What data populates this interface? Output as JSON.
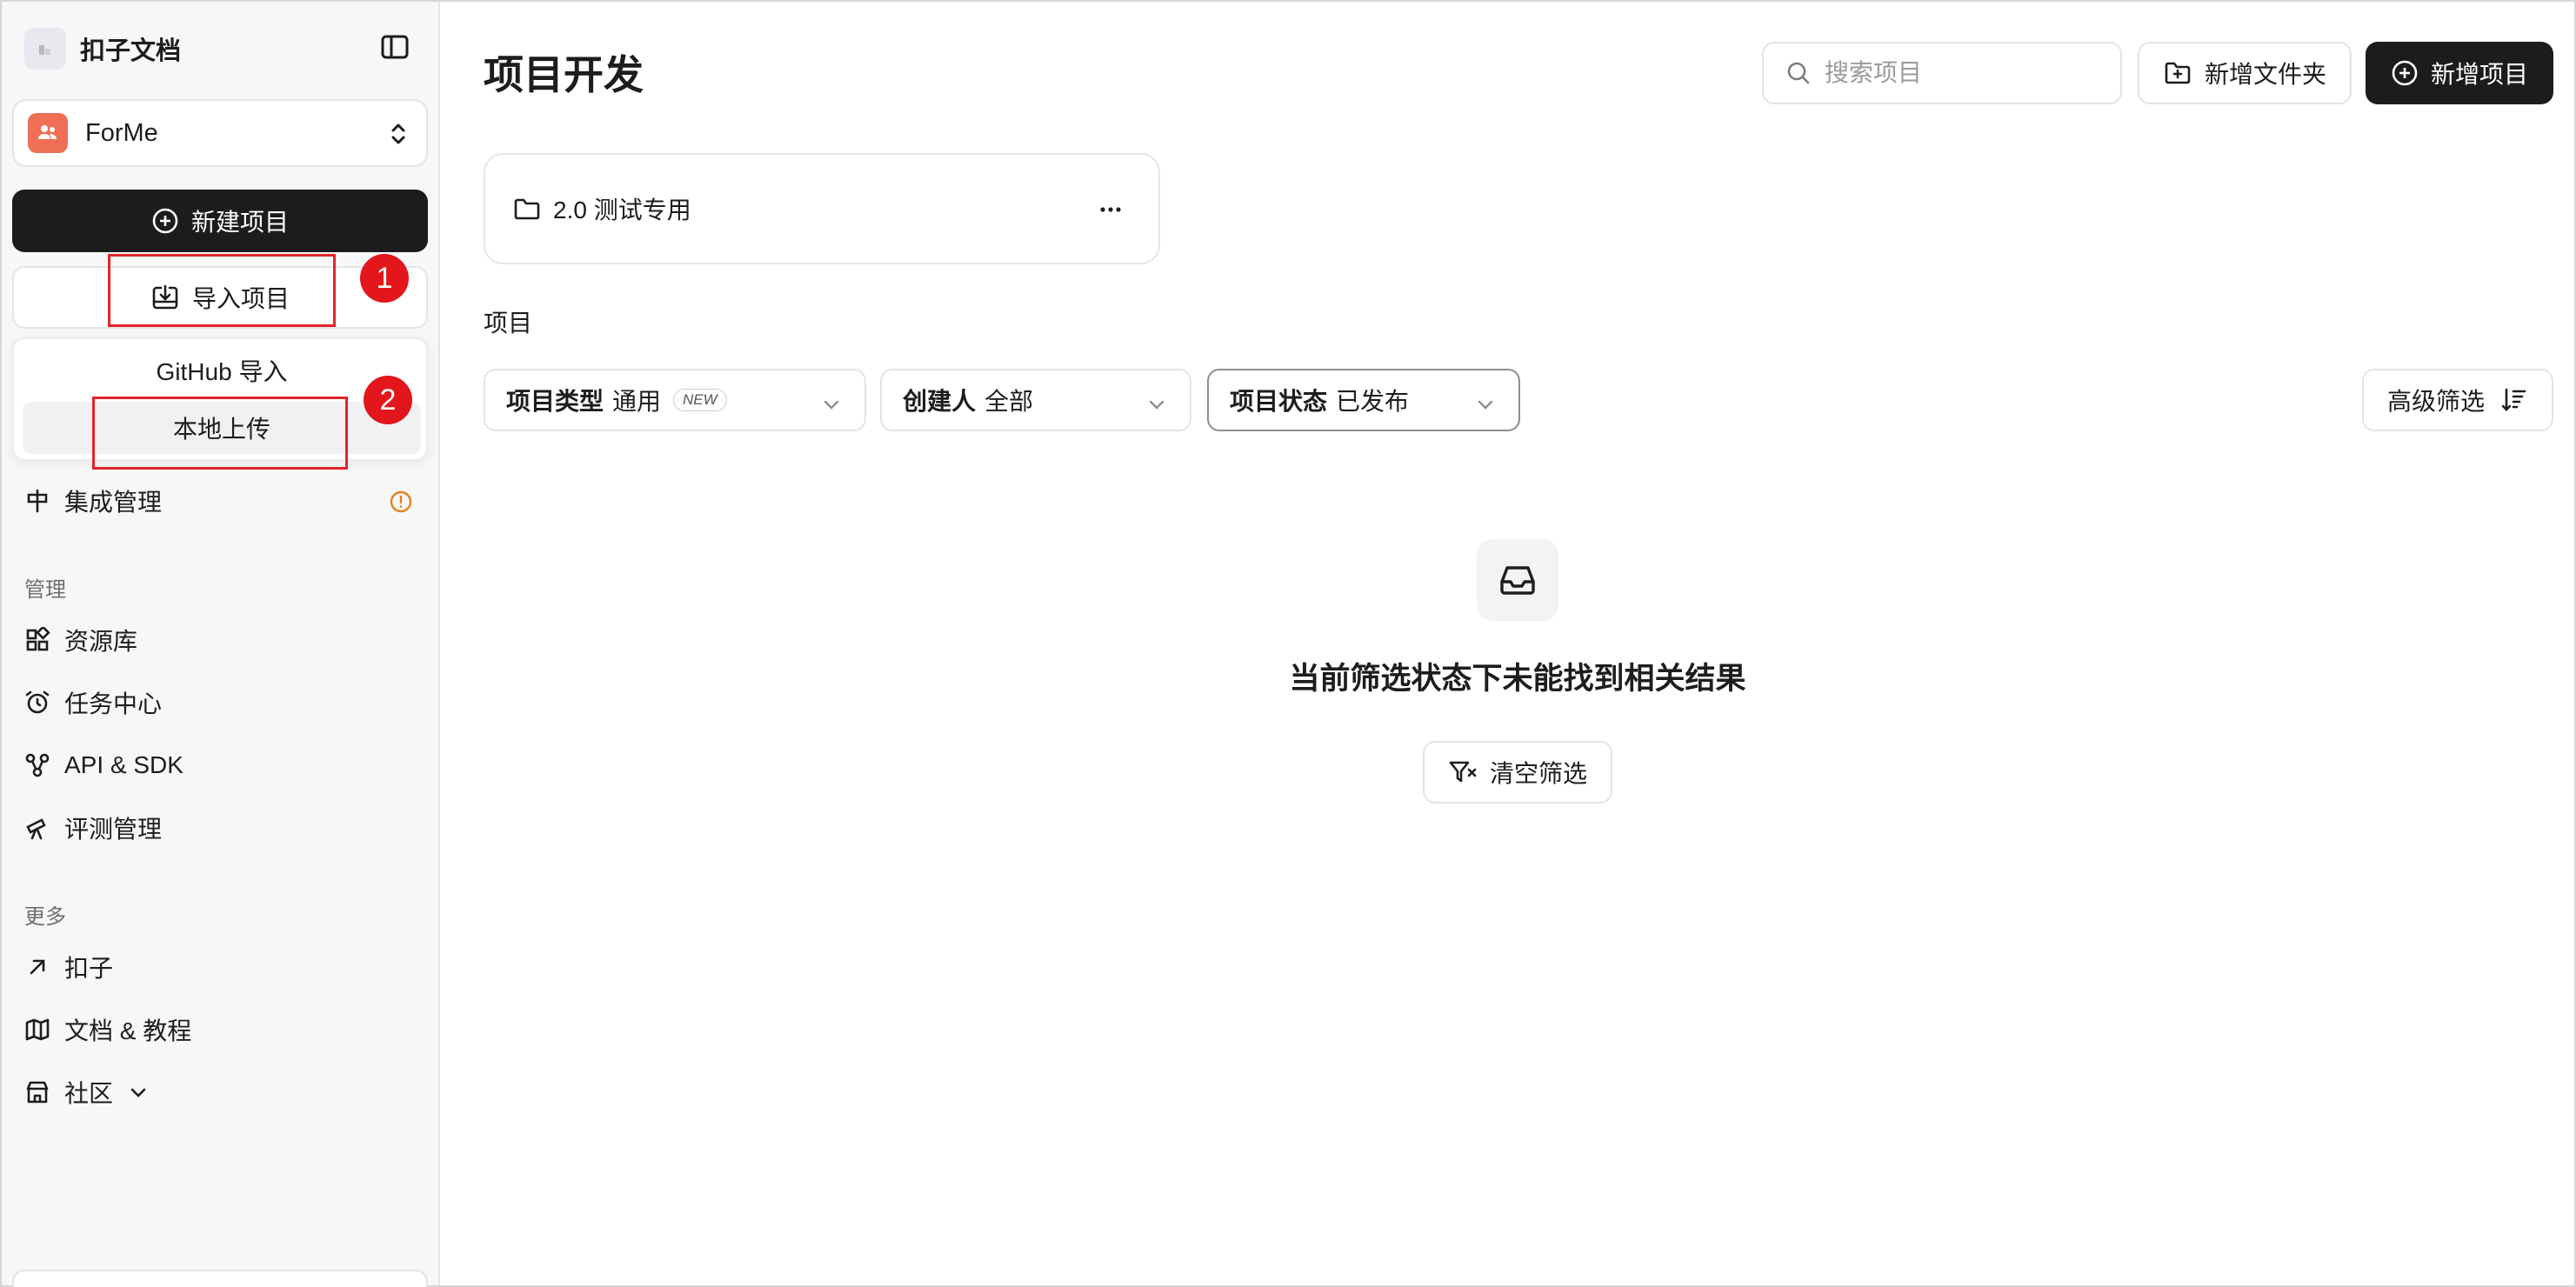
{
  "sidebar": {
    "brand_title": "扣子文档",
    "workspace_name": "ForMe",
    "new_project_label": "新建项目",
    "import_project_label": "导入项目",
    "import_menu": {
      "github": "GitHub 导入",
      "local": "本地上传"
    },
    "annotations": [
      "1",
      "2"
    ],
    "items_top": [
      {
        "label": "集成管理",
        "icon": "integration-icon"
      }
    ],
    "section_manage": "管理",
    "items_manage": [
      {
        "label": "资源库",
        "icon": "resource-library-icon"
      },
      {
        "label": "任务中心",
        "icon": "alarm-clock-icon"
      },
      {
        "label": "API & SDK",
        "icon": "api-nodes-icon"
      },
      {
        "label": "评测管理",
        "icon": "telescope-icon"
      }
    ],
    "section_more": "更多",
    "items_more": [
      {
        "label": "扣子",
        "icon": "arrow-up-right-icon"
      },
      {
        "label": "文档 & 教程",
        "icon": "map-icon"
      },
      {
        "label": "社区",
        "icon": "store-icon"
      }
    ]
  },
  "main": {
    "title": "项目开发",
    "search_placeholder": "搜索项目",
    "add_folder_label": "新增文件夹",
    "add_project_label": "新增项目",
    "folder_name": "2.0 测试专用",
    "section_label": "项目",
    "filters": [
      {
        "key": "项目类型",
        "value": "通用",
        "badge": "NEW"
      },
      {
        "key": "创建人",
        "value": "全部"
      },
      {
        "key": "项目状态",
        "value": "已发布"
      }
    ],
    "advanced_filter_label": "高级筛选",
    "empty_message": "当前筛选状态下未能找到相关结果",
    "clear_filter_label": "清空筛选"
  },
  "colors": {
    "accent_dark": "#1c1c1e",
    "workspace_avatar": "#ee6f56",
    "annotation_red": "#e3161c",
    "warning_orange": "#e8801a"
  }
}
